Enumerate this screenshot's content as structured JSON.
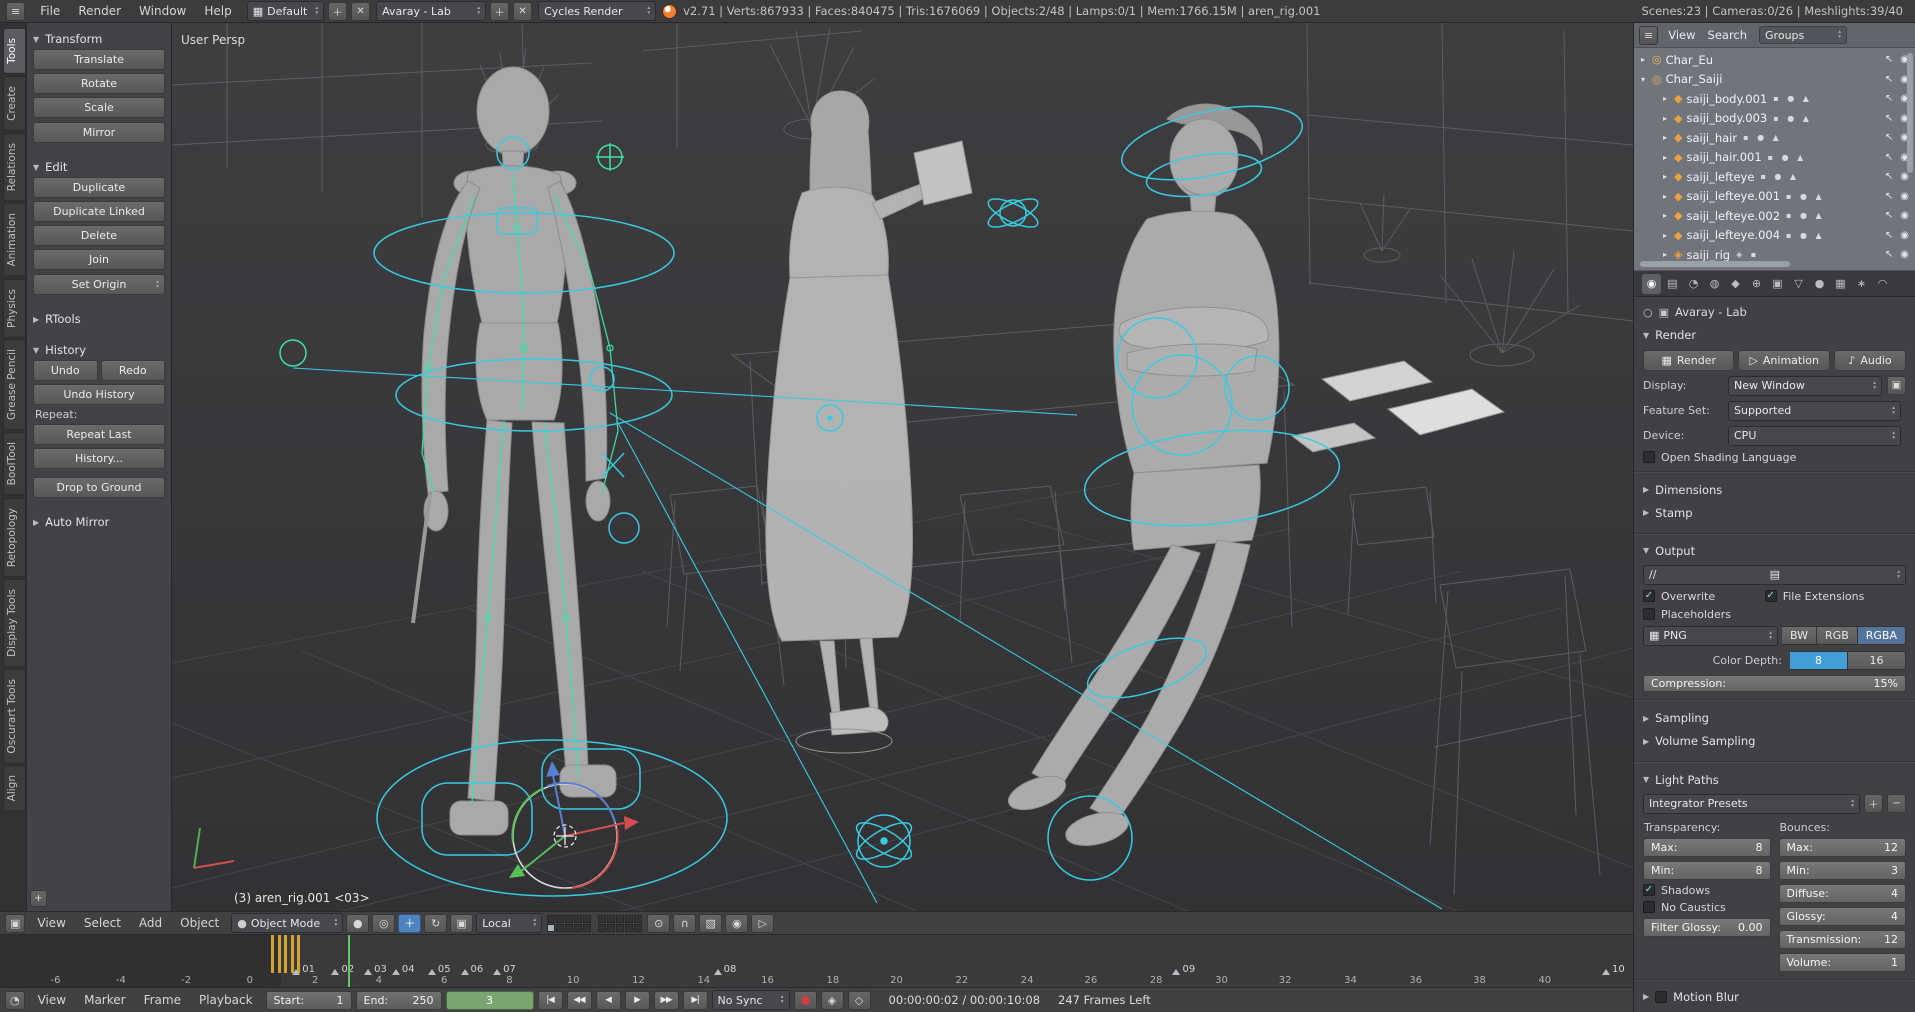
{
  "topbar": {
    "menus": [
      "File",
      "Render",
      "Window",
      "Help"
    ],
    "layout": "Default",
    "scene": "Avaray - Lab",
    "engine": "Cycles Render",
    "stats": "v2.71 | Verts:867933 | Faces:840475 | Tris:1676069 | Objects:2/48 | Lamps:0/1 | Mem:1766.15M | aren_rig.001",
    "stats_right": "Scenes:23 | Cameras:0/26 | Meshlights:39/40"
  },
  "toolshelf": {
    "tabs": [
      {
        "label": "Tools",
        "cls": "on"
      },
      {
        "label": "Create"
      },
      {
        "label": "Relations"
      },
      {
        "label": "Animation"
      },
      {
        "label": "Physics"
      },
      {
        "label": "Grease Pencil"
      },
      {
        "label": "BoolTool"
      },
      {
        "label": "Retopology"
      },
      {
        "label": "Display Tools"
      },
      {
        "label": "Oscurart Tools"
      },
      {
        "label": "Align"
      }
    ],
    "transform": {
      "title": "Transform",
      "buttons": [
        {
          "label": "Translate"
        },
        {
          "label": "Rotate"
        },
        {
          "label": "Scale"
        }
      ],
      "mirror": "Mirror"
    },
    "edit": {
      "title": "Edit",
      "buttons": [
        {
          "label": "Duplicate"
        },
        {
          "label": "Duplicate Linked"
        },
        {
          "label": "Delete"
        },
        {
          "label": "Join"
        }
      ],
      "set_origin": "Set Origin"
    },
    "rtools": "RTools",
    "history": {
      "title": "History",
      "undo": "Undo",
      "redo": "Redo",
      "undo_history": "Undo History",
      "repeat_label": "Repeat:",
      "repeat_last": "Repeat Last",
      "history_menu": "History...",
      "drop_to_ground": "Drop to Ground"
    },
    "auto_mirror": "Auto Mirror",
    "expand_plus": "+"
  },
  "viewport": {
    "view_label": "User Persp",
    "active_object": "(3) aren_rig.001 <03>"
  },
  "vheader": {
    "menus": [
      "View",
      "Select",
      "Add",
      "Object"
    ],
    "mode": "Object Mode",
    "orientation": "Local"
  },
  "outliner": {
    "view": "View",
    "search": "Search",
    "display_mode": "Groups",
    "rows": [
      {
        "name": "Char_Eu",
        "exp": "▸",
        "icon": "◎",
        "trail": "",
        "cls": "group"
      },
      {
        "name": "Char_Saiji",
        "exp": "▾",
        "icon": "◎",
        "trail": "",
        "cls": "group"
      },
      {
        "name": "saiji_body.001",
        "exp": "▸",
        "icon": "◆",
        "trail": "▪ ● ▲",
        "cls": "child"
      },
      {
        "name": "saiji_body.003",
        "exp": "▸",
        "icon": "◆",
        "trail": "▪ ● ▲",
        "cls": "child"
      },
      {
        "name": "saiji_hair",
        "exp": "▸",
        "icon": "◆",
        "trail": "▪ ● ▲",
        "cls": "child"
      },
      {
        "name": "saiji_hair.001",
        "exp": "▸",
        "icon": "◆",
        "trail": "▪ ● ▲",
        "cls": "child"
      },
      {
        "name": "saiji_lefteye",
        "exp": "▸",
        "icon": "◆",
        "trail": "▪ ● ▲",
        "cls": "child"
      },
      {
        "name": "saiji_lefteye.001",
        "exp": "▸",
        "icon": "◆",
        "trail": "▪ ● ▲",
        "cls": "child"
      },
      {
        "name": "saiji_lefteye.002",
        "exp": "▸",
        "icon": "◆",
        "trail": "▪ ● ▲",
        "cls": "child"
      },
      {
        "name": "saiji_lefteye.004",
        "exp": "▸",
        "icon": "◆",
        "trail": "▪ ● ▲",
        "cls": "child"
      },
      {
        "name": "saiji_rig",
        "exp": "▸",
        "icon": "◈",
        "trail": "◈ ▪",
        "cls": "child"
      }
    ]
  },
  "timeline": {
    "ruler": [
      {
        "label": "-6",
        "pos": 3.4
      },
      {
        "label": "-4",
        "pos": 7.4
      },
      {
        "label": "-2",
        "pos": 11.4
      },
      {
        "label": "0",
        "pos": 15.3
      },
      {
        "label": "2",
        "pos": 19.3
      },
      {
        "label": "4",
        "pos": 23.2
      },
      {
        "label": "6",
        "pos": 27.2
      },
      {
        "label": "8",
        "pos": 31.2
      },
      {
        "label": "10",
        "pos": 35.1
      },
      {
        "label": "12",
        "pos": 39.1
      },
      {
        "label": "14",
        "pos": 43.1
      },
      {
        "label": "16",
        "pos": 47.0
      },
      {
        "label": "18",
        "pos": 51.0
      },
      {
        "label": "20",
        "pos": 54.9
      },
      {
        "label": "22",
        "pos": 58.9
      },
      {
        "label": "24",
        "pos": 62.9
      },
      {
        "label": "26",
        "pos": 66.8
      },
      {
        "label": "28",
        "pos": 70.8
      },
      {
        "label": "30",
        "pos": 74.8
      },
      {
        "label": "32",
        "pos": 78.7
      },
      {
        "label": "34",
        "pos": 82.7
      },
      {
        "label": "36",
        "pos": 86.7
      },
      {
        "label": "38",
        "pos": 90.6
      },
      {
        "label": "40",
        "pos": 94.6
      }
    ],
    "markers": [
      {
        "label": "01",
        "pos": 17.9
      },
      {
        "label": "02",
        "pos": 20.3
      },
      {
        "label": "03",
        "pos": 22.3
      },
      {
        "label": "04",
        "pos": 24.0
      },
      {
        "label": "05",
        "pos": 26.2
      },
      {
        "label": "06",
        "pos": 28.2
      },
      {
        "label": "07",
        "pos": 30.2
      },
      {
        "label": "08",
        "pos": 43.7
      },
      {
        "label": "09",
        "pos": 71.8
      },
      {
        "label": "10",
        "pos": 98.1
      }
    ],
    "keyframes": [
      {
        "pos": 16.6
      },
      {
        "pos": 17.0
      },
      {
        "pos": 17.4
      },
      {
        "pos": 17.8
      },
      {
        "pos": 18.2
      }
    ],
    "playhead_style": "left:21.3%"
  },
  "theader": {
    "menus": [
      "View",
      "Marker",
      "Frame",
      "Playback"
    ],
    "start_label": "Start:",
    "start_value": "1",
    "end_label": "End:",
    "end_value": "250",
    "current": "3",
    "playback": [
      "|◀",
      "◀◀",
      "◀",
      "▶",
      "▶▶",
      "▶|"
    ],
    "sync": "No Sync",
    "timecode": "00:00:00:02 / 00:00:10:08",
    "frames_left": "247 Frames Left"
  },
  "props": {
    "tabs": [
      {
        "glyph": "◉",
        "name": "render",
        "cls": "on"
      },
      {
        "glyph": "▤",
        "name": "render-layers"
      },
      {
        "glyph": "◔",
        "name": "scene"
      },
      {
        "glyph": "◍",
        "name": "world"
      },
      {
        "glyph": "◆",
        "name": "object"
      },
      {
        "glyph": "⊕",
        "name": "constraints"
      },
      {
        "glyph": "▣",
        "name": "modifiers"
      },
      {
        "glyph": "▽",
        "name": "object-data"
      },
      {
        "glyph": "●",
        "name": "material"
      },
      {
        "glyph": "▦",
        "name": "texture"
      },
      {
        "glyph": "∗",
        "name": "particles"
      },
      {
        "glyph": "◠",
        "name": "physics"
      }
    ],
    "context": "Avaray - Lab",
    "render": {
      "title": "Render",
      "btn_render": "Render",
      "btn_animation": "Animation",
      "btn_audio": "Audio",
      "display_label": "Display:",
      "display_value": "New Window",
      "feature_label": "Feature Set:",
      "feature_value": "Supported",
      "device_label": "Device:",
      "device_value": "CPU",
      "osl": "Open Shading Language"
    },
    "collapsed1": [
      {
        "label": "Dimensions"
      },
      {
        "label": "Stamp"
      }
    ],
    "output": {
      "title": "Output",
      "path": "//",
      "overwrite": "Overwrite",
      "file_ext": "File Extensions",
      "placeholders": "Placeholders",
      "format": "PNG",
      "channels": [
        {
          "label": "BW"
        },
        {
          "label": "RGB"
        },
        {
          "label": "RGBA",
          "cls": "on"
        }
      ],
      "depth_label": "Color Depth:",
      "depths": [
        {
          "label": "8",
          "cls": "on2"
        },
        {
          "label": "16"
        }
      ],
      "comp_label": "Compression:",
      "comp_value": "15%"
    },
    "collapsed2": [
      {
        "label": "Sampling"
      },
      {
        "label": "Volume Sampling"
      }
    ],
    "lightpaths": {
      "title": "Light Paths",
      "presets": "Integrator Presets",
      "left_title": "Transparency:",
      "right_title": "Bounces:",
      "left_fields": [
        {
          "label": "Max:",
          "value": "8"
        },
        {
          "label": "Min:",
          "value": "8"
        }
      ],
      "right_fields": [
        {
          "label": "Max:",
          "value": "12"
        },
        {
          "label": "Min:",
          "value": "3"
        },
        {
          "label": "Diffuse:",
          "value": "4"
        },
        {
          "label": "Glossy:",
          "value": "4"
        },
        {
          "label": "Transmission:",
          "value": "12"
        },
        {
          "label": "Volume:",
          "value": "1"
        }
      ],
      "shadows": "Shadows",
      "no_caustics": "No Caustics",
      "filter_glossy_label": "Filter Glossy:",
      "filter_glossy_value": "0.00"
    },
    "motion_blur": "Motion Blur"
  }
}
